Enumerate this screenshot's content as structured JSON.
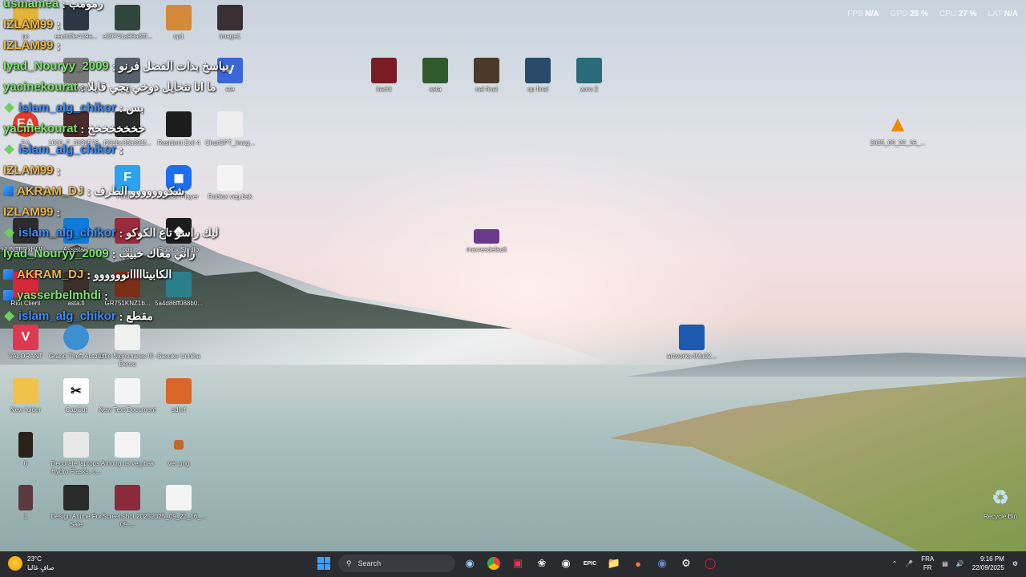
{
  "hud": {
    "fps_label": "FPS",
    "fps_value": "N/A",
    "gpu_label": "GPU",
    "gpu_value": "25 %",
    "cpu_label": "CPU",
    "cpu_value": "27 %",
    "lat_label": "LAT",
    "lat_value": "N/A"
  },
  "chat": [
    {
      "user": "usmamea",
      "sep": " : ",
      "msg": "رمومب",
      "color": "#7de36b",
      "badge": ""
    },
    {
      "user": "IZLAM99",
      "sep": " : ",
      "msg": "",
      "color": "#e8b84a",
      "badge": ""
    },
    {
      "user": "IZLAM99",
      "sep": " : ",
      "msg": "",
      "color": "#e8b84a",
      "badge": ""
    },
    {
      "user": "Iyad_Nouryy_2009",
      "sep": " : ",
      "msg": "بياسخ بدات الفضل فرنو",
      "color": "#7de36b",
      "badge": ""
    },
    {
      "user": "yacinekourat",
      "sep": " : ",
      "msg": "ما انا نتخايل دوخي يجي قابلا",
      "color": "#7de36b",
      "badge": ""
    },
    {
      "user": "islam_alg_chikor",
      "sep": " : ",
      "msg": "بس",
      "color": "#3a8dff",
      "badge": "diamond"
    },
    {
      "user": "yacinekourat",
      "sep": " : ",
      "msg": "خخخخخخخخ",
      "color": "#7de36b",
      "badge": ""
    },
    {
      "user": "islam_alg_chikor",
      "sep": " : ",
      "msg": "",
      "color": "#3a8dff",
      "badge": "diamond"
    },
    {
      "user": "IZLAM99",
      "sep": " : ",
      "msg": "",
      "color": "#e8b84a",
      "badge": ""
    },
    {
      "user": "AKRAM_DJ",
      "sep": " : ",
      "msg": "شكووووووو الطرف",
      "color": "#e8b84a",
      "badge": "arrows"
    },
    {
      "user": "IZLAM99",
      "sep": " : ",
      "msg": "",
      "color": "#e8b84a",
      "badge": ""
    },
    {
      "user": "islam_alg_chikor",
      "sep": " : ",
      "msg": "ليك راسو تاع الكوكو",
      "color": "#3a8dff",
      "badge": "diamond"
    },
    {
      "user": "Iyad_Nouryy_2009",
      "sep": " : ",
      "msg": "راني معاك خبيب",
      "color": "#7de36b",
      "badge": ""
    },
    {
      "user": "AKRAM_DJ",
      "sep": " : ",
      "msg": "الكابيتااااانوووووو",
      "color": "#e8b84a",
      "badge": "arrows"
    },
    {
      "user": "yasserbelmhdi",
      "sep": " : ",
      "msg": "",
      "color": "#7de36b",
      "badge": "arrows"
    },
    {
      "user": "islam_alg_chikor",
      "sep": " : ",
      "msg": "مقطع",
      "color": "#3a8dff",
      "badge": "diamond"
    }
  ],
  "icons": [
    {
      "label": "pc",
      "glyph": "",
      "color": "#e4b43a"
    },
    {
      "label": "eachf3e419a...",
      "glyph": "",
      "color": "#2b3744"
    },
    {
      "label": "e20741a99a8fff...",
      "glyph": "",
      "color": "#31463b"
    },
    {
      "label": "op1",
      "glyph": "",
      "color": "#d58a3a"
    },
    {
      "label": "image1",
      "glyph": "",
      "color": "#3a3034"
    },
    {
      "label": "IZLAM99",
      "glyph": "",
      "color": "#777777"
    },
    {
      "label": "V",
      "glyph": "V",
      "color": "#3a66d8"
    },
    {
      "label": "25",
      "glyph": "",
      "color": "#55606a"
    },
    {
      "label": "EA",
      "glyph": "EA",
      "color": "#e23b2a"
    },
    {
      "label": "1000_F_5839578...",
      "glyph": "",
      "color": "#4a2a2a"
    },
    {
      "label": "f93dbc35b391f...",
      "glyph": "",
      "color": "#2b2b2b"
    },
    {
      "label": "Resident Evil 4",
      "glyph": "",
      "color": "#1c1c1c"
    },
    {
      "label": "ChatGPT_Imag...",
      "glyph": "",
      "color": "#eeeeee"
    },
    {
      "label": "Fortnite",
      "glyph": "F",
      "color": "#2aa3f0"
    },
    {
      "label": "Roblox Player",
      "glyph": "◼",
      "color": "#1c6ef0"
    },
    {
      "label": "Roblox veg.bak",
      "glyph": "",
      "color": "#f4f4f4"
    },
    {
      "label": "HUNTERxHUN...",
      "glyph": "",
      "color": "#2c2c2c"
    },
    {
      "label": "Assistant",
      "glyph": "",
      "color": "#0f7ad8"
    },
    {
      "label": "ops",
      "glyph": "",
      "color": "#9a2b3a"
    },
    {
      "label": "Roblox Studio",
      "glyph": "◆",
      "color": "#1c1c1c"
    },
    {
      "label": "Riot Client",
      "glyph": "",
      "color": "#d6283b"
    },
    {
      "label": "asta.fi",
      "glyph": "",
      "color": "#3a2f2a"
    },
    {
      "label": "GR751KNZ1b...",
      "glyph": "",
      "color": "#7a2e18"
    },
    {
      "label": "5a4d86ff088b0...",
      "glyph": "",
      "color": "#2a7f8a"
    },
    {
      "label": "VALORANT",
      "glyph": "V",
      "color": "#e0384e"
    },
    {
      "label": "Grand Theft Auto V",
      "glyph": "",
      "color": "#3c8fd0"
    },
    {
      "label": "Little Nightmares III - Demo",
      "glyph": "",
      "color": "#f0f0f0"
    },
    {
      "label": "Sasuke Uchiha",
      "glyph": "",
      "color": "#ffffff"
    },
    {
      "label": "New folder",
      "glyph": "",
      "color": "#f0c24a"
    },
    {
      "label": "CapCut",
      "glyph": "✂",
      "color": "#ffffff"
    },
    {
      "label": "New Text Document",
      "glyph": "",
      "color": "#f4f4f4"
    },
    {
      "label": "sdhrf",
      "glyph": "",
      "color": "#d8662a"
    },
    {
      "label": "0",
      "glyph": "",
      "color": "#2a2218"
    },
    {
      "label": "Decorate laptops, Hydro Flasks, c...",
      "glyph": "",
      "color": "#e8e8e8"
    },
    {
      "label": "Among us.veg.bak",
      "glyph": "",
      "color": "#f4f4f4"
    },
    {
      "label": "ver png",
      "glyph": "",
      "color": "#c06a2a"
    },
    {
      "label": "1",
      "glyph": "",
      "color": "#5a3a40"
    },
    {
      "label": "Design Anime For Sale",
      "glyph": "",
      "color": "#2a2a2a"
    },
    {
      "label": "Screenshot 2025-09-...",
      "glyph": "",
      "color": "#8a2a3a"
    },
    {
      "label": "2025_09_22_16_...",
      "glyph": "",
      "color": "#f4f4f4"
    },
    {
      "label": "itachi",
      "glyph": "",
      "color": "#7a1c24"
    },
    {
      "label": "asta",
      "glyph": "",
      "color": "#2e5a2e"
    },
    {
      "label": "oal final",
      "glyph": "",
      "color": "#4a3a2a"
    },
    {
      "label": "op final",
      "glyph": "",
      "color": "#2a4a6a"
    },
    {
      "label": "zoro 2",
      "glyph": "",
      "color": "#2a6a7a"
    },
    {
      "label": "maxresdefault",
      "glyph": "",
      "color": "#6a3a8a"
    },
    {
      "label": "artworks-IMu02...",
      "glyph": "",
      "color": "#1c5ab0"
    },
    {
      "label": "2025_09_22_16_...",
      "glyph": "▲",
      "color": "#f08a00"
    },
    {
      "label": "Recycle Bin",
      "glyph": "♻",
      "color": "#9fd0e8"
    }
  ],
  "taskbar": {
    "weather_temp": "23°C",
    "weather_desc": "صافٍ غالبا",
    "search_placeholder": "Search",
    "lang_top": "FRA",
    "lang_bottom": "FR",
    "time": "9:16 PM",
    "date": "22/09/2025"
  }
}
